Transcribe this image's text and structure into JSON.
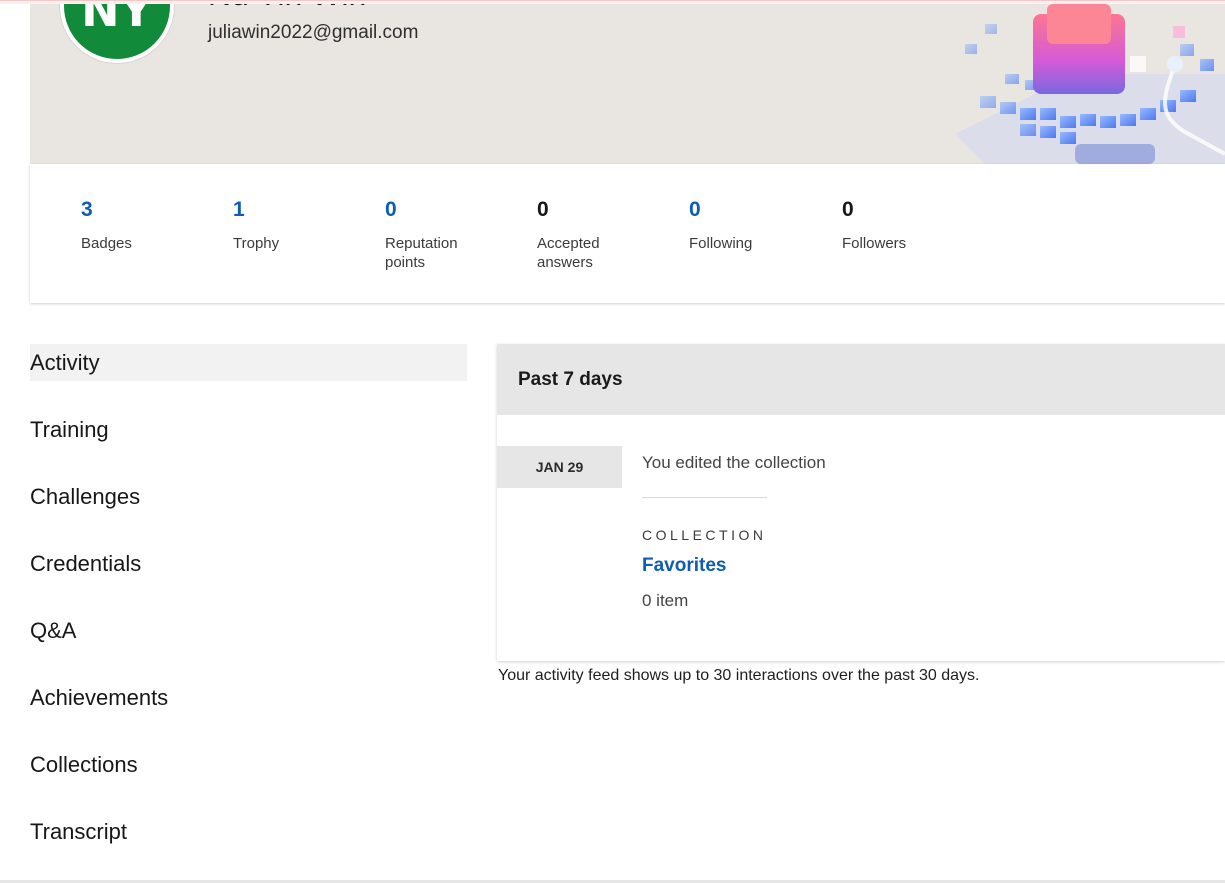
{
  "profile": {
    "initials": "NY",
    "name": "Nu Yin Win",
    "email": "juliawin2022@gmail.com"
  },
  "stats": [
    {
      "value": "3",
      "label": "Badges",
      "linked": true
    },
    {
      "value": "1",
      "label": "Trophy",
      "linked": true
    },
    {
      "value": "0",
      "label": "Reputation points",
      "linked": true
    },
    {
      "value": "0",
      "label": "Accepted answers",
      "linked": false
    },
    {
      "value": "0",
      "label": "Following",
      "linked": true
    },
    {
      "value": "0",
      "label": "Followers",
      "linked": false
    }
  ],
  "sidebar": {
    "items": [
      {
        "label": "Activity",
        "active": true
      },
      {
        "label": "Training"
      },
      {
        "label": "Challenges"
      },
      {
        "label": "Credentials"
      },
      {
        "label": "Q&A"
      },
      {
        "label": "Achievements"
      },
      {
        "label": "Collections"
      },
      {
        "label": "Transcript"
      }
    ]
  },
  "activity": {
    "period": "Past 7 days",
    "events": [
      {
        "date": "JAN 29",
        "text": "You edited the collection",
        "kind": "COLLECTION",
        "title": "Favorites",
        "count": "0 item"
      }
    ],
    "footnote": "Your activity feed shows up to 30 interactions over the past 30 days."
  },
  "colors": {
    "link": "#0f5cb0",
    "avatar": "#118a3a",
    "banner": "#e9e6e1"
  }
}
